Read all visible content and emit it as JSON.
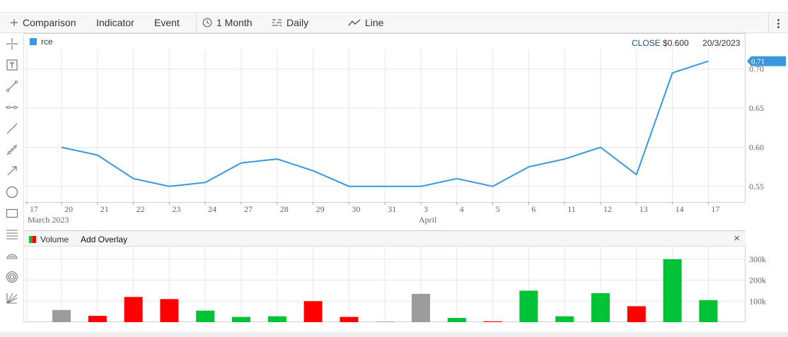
{
  "toolbar": {
    "comparison_label": "Comparison",
    "indicator_label": "Indicator",
    "event_label": "Event",
    "period_label": "1 Month",
    "interval_label": "Daily",
    "chart_type_label": "Line"
  },
  "sidebar": {
    "tools": [
      "crosshair-icon",
      "text-tool-icon",
      "segment-icon",
      "ray-icon",
      "line-icon",
      "multi-point-icon",
      "arrow-icon",
      "circle-icon",
      "rectangle-icon",
      "fibonacci-icon",
      "arc-icon",
      "target-icon",
      "gann-fan-icon"
    ]
  },
  "legend": {
    "series_label": "rce",
    "series_color": "#3a96dd"
  },
  "close_readout": {
    "label": "CLOSE",
    "value": "$0.600",
    "date": "20/3/2023"
  },
  "last_price_badge": "0.71",
  "volume_panel": {
    "title": "Volume",
    "add_overlay_label": "Add Overlay",
    "close_symbol": "×"
  },
  "colors": {
    "up": "#00c234",
    "down": "#ff0000",
    "neutral": "#9b9b9b",
    "line": "#3a96dd",
    "badge": "#3a96dd"
  },
  "chart_data": [
    {
      "type": "line",
      "x_month_labels": [
        "March 2023",
        "April"
      ],
      "x": [
        "17",
        "20",
        "21",
        "22",
        "23",
        "24",
        "27",
        "28",
        "29",
        "30",
        "31",
        "3",
        "4",
        "5",
        "6",
        "11",
        "12",
        "13",
        "14",
        "17"
      ],
      "y_ticks": [
        "0.55",
        "0.60",
        "0.65",
        "0.70"
      ],
      "ylim": [
        0.53,
        0.725
      ],
      "values": [
        null,
        0.6,
        0.59,
        0.56,
        0.55,
        0.555,
        0.58,
        0.585,
        0.57,
        0.55,
        0.55,
        0.55,
        0.56,
        0.55,
        0.575,
        0.585,
        0.6,
        0.565,
        0.695,
        0.71
      ],
      "grid": true
    },
    {
      "type": "bar",
      "x": [
        "17",
        "20",
        "21",
        "22",
        "23",
        "24",
        "27",
        "28",
        "29",
        "30",
        "31",
        "3",
        "4",
        "5",
        "6",
        "11",
        "12",
        "13",
        "14",
        "17"
      ],
      "y_ticks": [
        "100k",
        "200k",
        "300k"
      ],
      "ylim": [
        0,
        360000
      ],
      "values": [
        null,
        58000,
        30000,
        120000,
        110000,
        55000,
        25000,
        28000,
        100000,
        25000,
        3000,
        135000,
        20000,
        4000,
        150000,
        28000,
        138000,
        76000,
        300000,
        105000
      ],
      "bar_colors": [
        null,
        "neutral",
        "down",
        "down",
        "down",
        "up",
        "up",
        "up",
        "down",
        "down",
        "neutral",
        "neutral",
        "up",
        "down",
        "up",
        "up",
        "up",
        "down",
        "up",
        "up"
      ],
      "grid": true
    }
  ]
}
